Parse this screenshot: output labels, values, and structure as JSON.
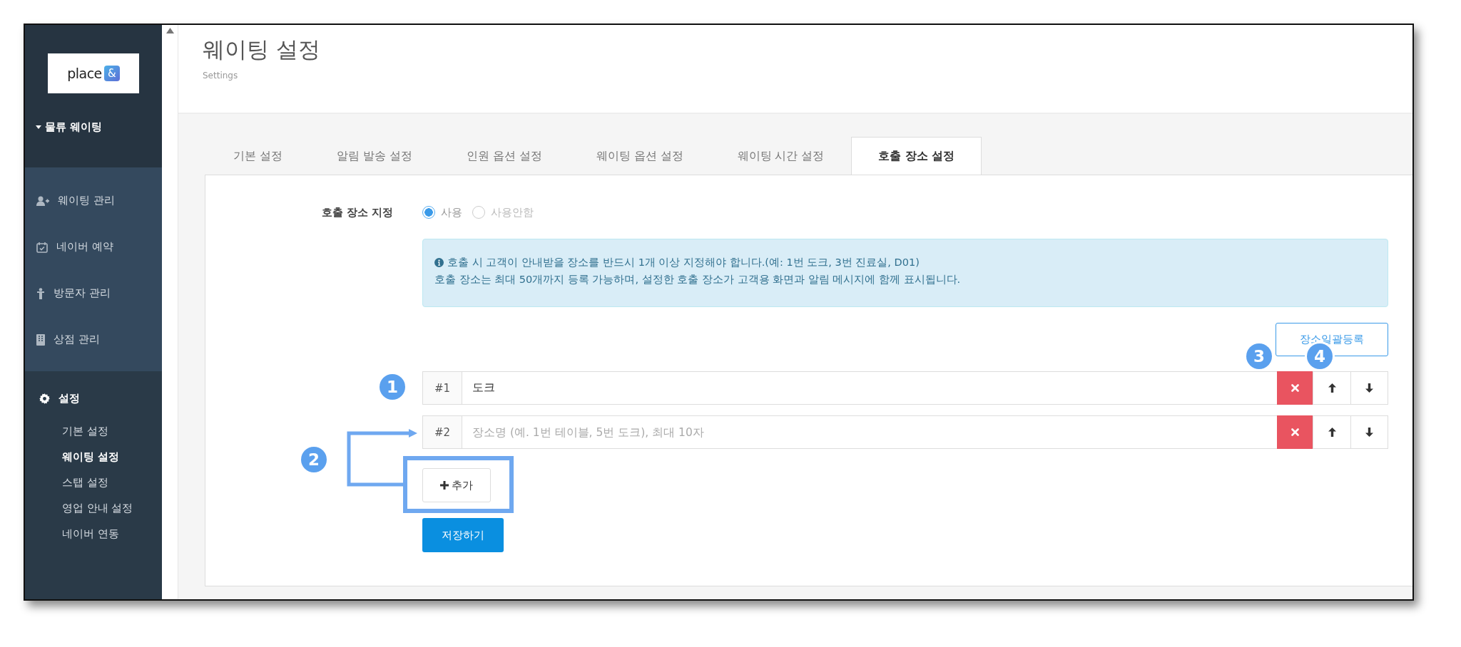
{
  "sidebar": {
    "logo": {
      "text": "place",
      "mark": "&"
    },
    "section": {
      "label": "물류 웨이팅",
      "expanded": true
    },
    "items": [
      {
        "label": "웨이팅 관리",
        "kind": "user-add"
      },
      {
        "label": "네이버 예약",
        "kind": "calendar"
      },
      {
        "label": "방문자 관리",
        "kind": "person"
      },
      {
        "label": "상점 관리",
        "kind": "building"
      }
    ],
    "settings": {
      "label": "설정",
      "kind": "gear",
      "children": [
        {
          "label": "기본 설정",
          "selected": false
        },
        {
          "label": "웨이팅 설정",
          "selected": true
        },
        {
          "label": "스탭 설정",
          "selected": false
        },
        {
          "label": "영업 안내 설정",
          "selected": false
        },
        {
          "label": "네이버 연동",
          "selected": false
        }
      ]
    }
  },
  "page": {
    "title": "웨이팅 설정",
    "subtitle": "Settings"
  },
  "tabs": [
    {
      "label": "기본 설정",
      "selected": false
    },
    {
      "label": "알림 발송 설정",
      "selected": false
    },
    {
      "label": "인원 옵션 설정",
      "selected": false
    },
    {
      "label": "웨이팅 옵션 설정",
      "selected": false
    },
    {
      "label": "웨이팅 시간 설정",
      "selected": false
    },
    {
      "label": "호출 장소 설정",
      "selected": true
    }
  ],
  "form": {
    "label": "호출 장소 지정",
    "options": [
      {
        "label": "사용",
        "selected": true
      },
      {
        "label": "사용안함",
        "selected": false
      }
    ],
    "info": [
      "호출 시 고객이 안내받을 장소를 반드시 1개 이상 지정해야 합니다.(예: 1번 도크, 3번 진료실, D01)",
      "호출 장소는 최대 50개까지 등록 가능하며, 설정한 호출 장소가 고객용 화면과 알림 메시지에 함께 표시됩니다."
    ],
    "bulk_button": "장소일괄등록",
    "rows": [
      {
        "index": "#1",
        "value": "도크"
      },
      {
        "index": "#2",
        "placeholder": "장소명 (예. 1번 테이블, 5번 도크), 최대 10자"
      }
    ],
    "add_button": "추가",
    "save_button": "저장하기"
  },
  "annotations": [
    "1",
    "2",
    "3",
    "4"
  ]
}
